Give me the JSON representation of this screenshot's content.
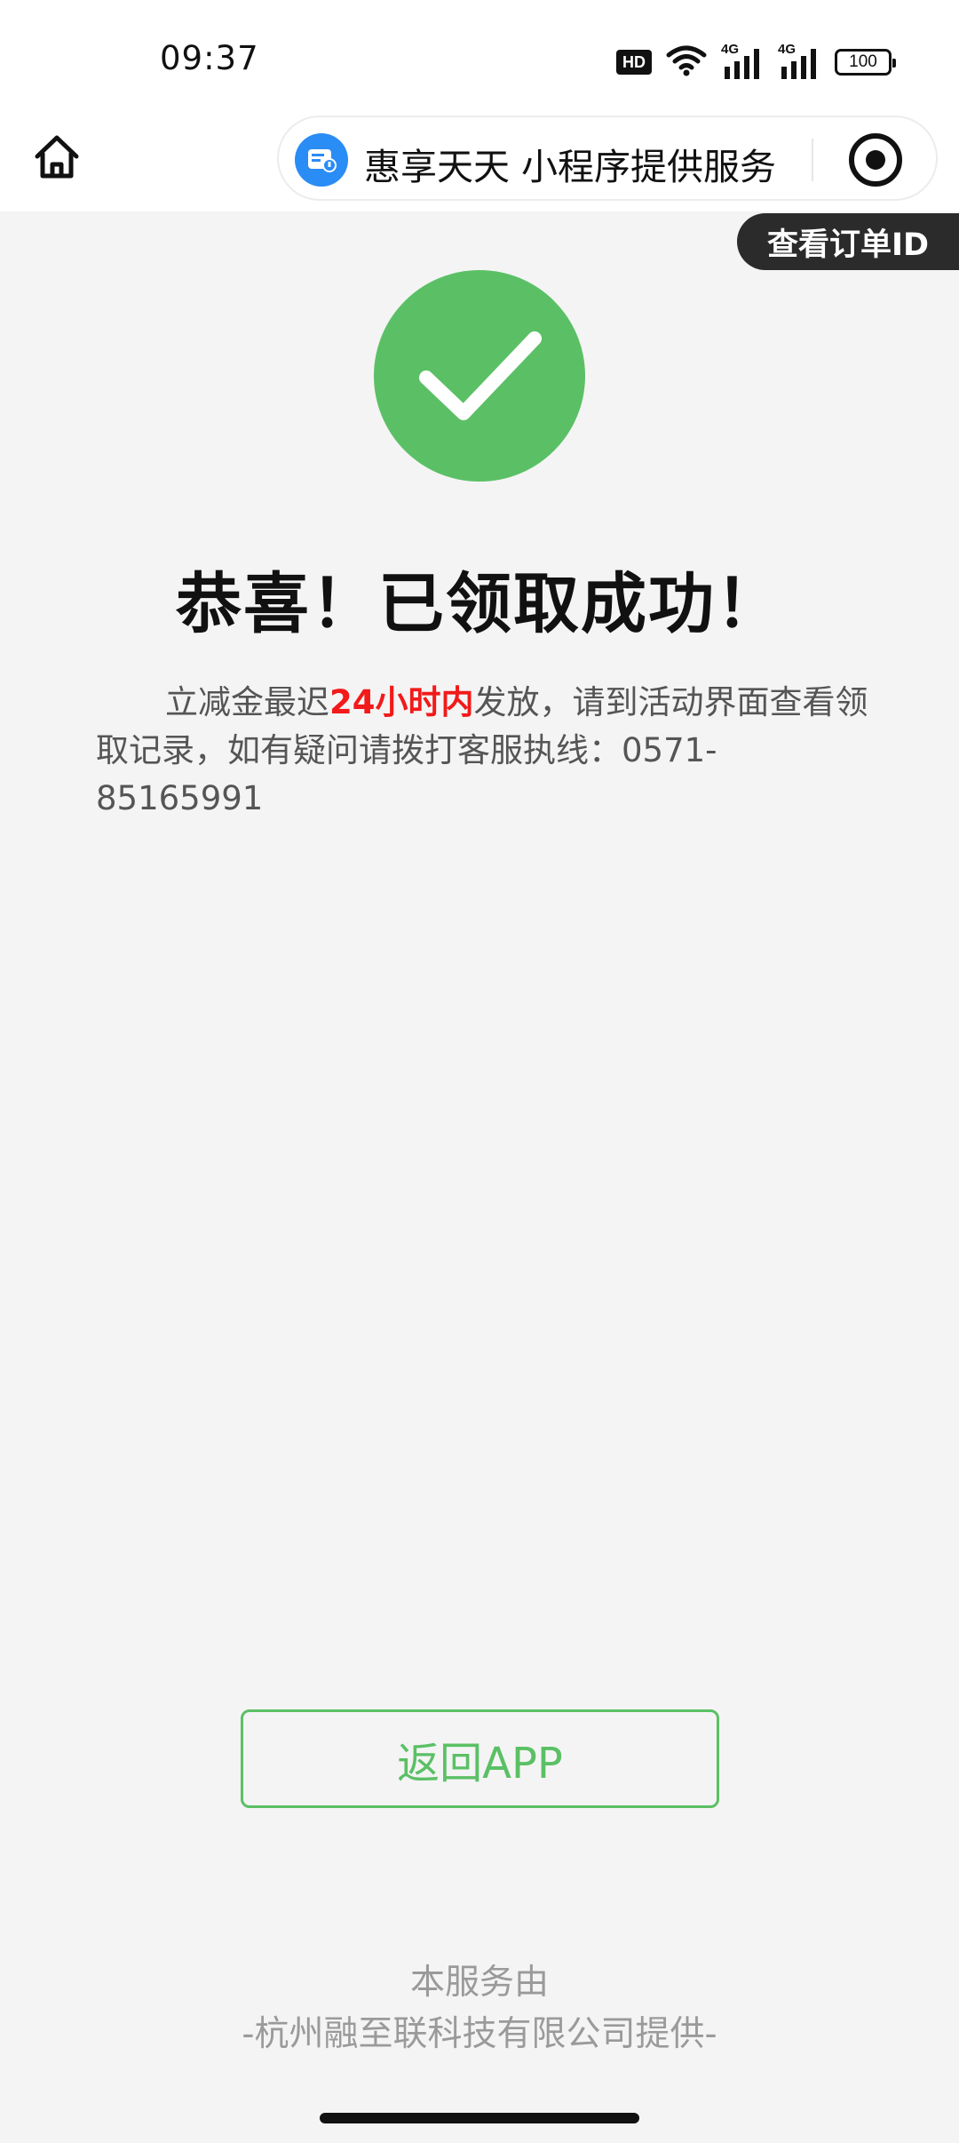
{
  "status_bar": {
    "time": "09:37",
    "hd_label": "HD",
    "signal1_label": "4G",
    "signal2_label": "4G",
    "battery": "100"
  },
  "nav": {
    "home_icon": "home-icon",
    "capsule_title": "惠享天天 小程序提供服务",
    "capsule_logo_icon": "miniprogram-logo-icon",
    "capsule_target_icon": "target-icon"
  },
  "order_id_button": "查看订单ID",
  "result": {
    "icon": "check-icon",
    "title": "恭喜！已领取成功！",
    "desc_before": "立减金最迟",
    "desc_highlight": "24小时内",
    "desc_after": "发放，请到活动界面查看领取记录，如有疑问请拨打客服执线：0571-85165991"
  },
  "back_button": "返回APP",
  "footer": {
    "line1": "本服务由",
    "line2": "-杭州融至联科技有限公司提供-"
  },
  "colors": {
    "accent_green": "#5bc065",
    "highlight_red": "#f21a1a",
    "background": "#f4f4f4"
  }
}
